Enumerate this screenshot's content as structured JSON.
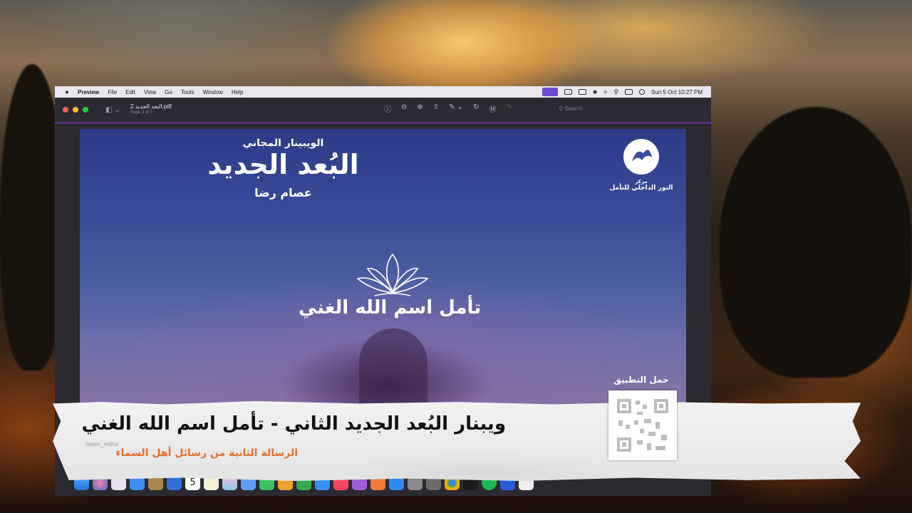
{
  "menubar": {
    "app_name": "Preview",
    "menus": [
      "File",
      "Edit",
      "View",
      "Go",
      "Tools",
      "Window",
      "Help"
    ],
    "clock": "Sun 5 Oct  10:27 PM"
  },
  "document": {
    "filename": "البعد الجديد 2.pdf",
    "page_indicator": "Page 3 of 7",
    "search_placeholder": "Search"
  },
  "slide": {
    "subtitle": "الويبينار المجاني",
    "title": "البُعد الجديد",
    "author": "عصام رضا",
    "meditation": "تأمل اسم الله الغني",
    "logo_text": "النور الداخلي للتأمل",
    "logo_small": "مركز"
  },
  "overlay": {
    "title": "ويبنار البُعد الجديد الثاني - تأمل اسم الله الغني",
    "subtitle": "الرسالة الثانية من رسائل أهل السماء",
    "watermark": "issam_redha",
    "download_app": "حمل التطبيق"
  },
  "dock": {
    "today_date": "5"
  },
  "colors": {
    "accent_purple": "#6e4ad3",
    "subtitle_orange": "#e2702b",
    "slide_blue": "#2c3a87"
  }
}
